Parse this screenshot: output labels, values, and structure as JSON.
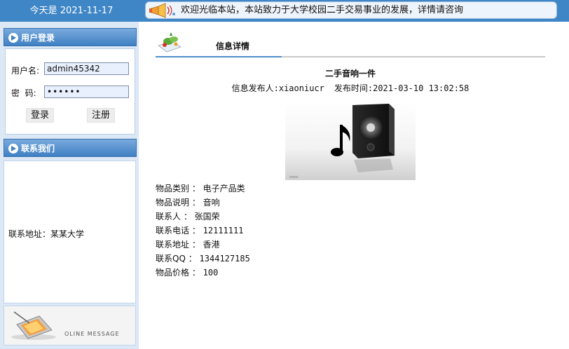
{
  "header": {
    "date_text": "今天是 2021-11-17",
    "notice": "欢迎光临本站，本站致力于大学校园二手交易事业的发展，详情请咨询"
  },
  "login": {
    "title": "用户登录",
    "username_label": "用户名:",
    "username_value": "admin45342",
    "password_label": "密  码:",
    "password_value": "••••••",
    "login_button": "登录",
    "register_button": "注册"
  },
  "contact": {
    "title": "联系我们",
    "address": "联系地址：某某大学"
  },
  "message_banner": {
    "text": "OLINE MESSAGE"
  },
  "main": {
    "tab_title": "信息详情",
    "item_title": "二手音响一件",
    "publisher_label": "信息发布人:",
    "publisher": "xiaoniucr",
    "time_label": "发布时间:",
    "time": "2021-03-10 13:02:58",
    "details": [
      {
        "label": "物品类别 ：",
        "value": "电子产品类"
      },
      {
        "label": "物品说明 ：",
        "value": "音响"
      },
      {
        "label": "联系人 ：",
        "value": "张国荣"
      },
      {
        "label": "联系电话 ：",
        "value": "12111111"
      },
      {
        "label": "联系地址 ：",
        "value": "香港"
      },
      {
        "label": "联系QQ ：",
        "value": "1344127185"
      },
      {
        "label": "物品价格 ：",
        "value": "100"
      }
    ]
  },
  "colors": {
    "topbar": "#3f86c6",
    "panel_head": "#3f80c3",
    "left_bg": "#dce8f5"
  }
}
